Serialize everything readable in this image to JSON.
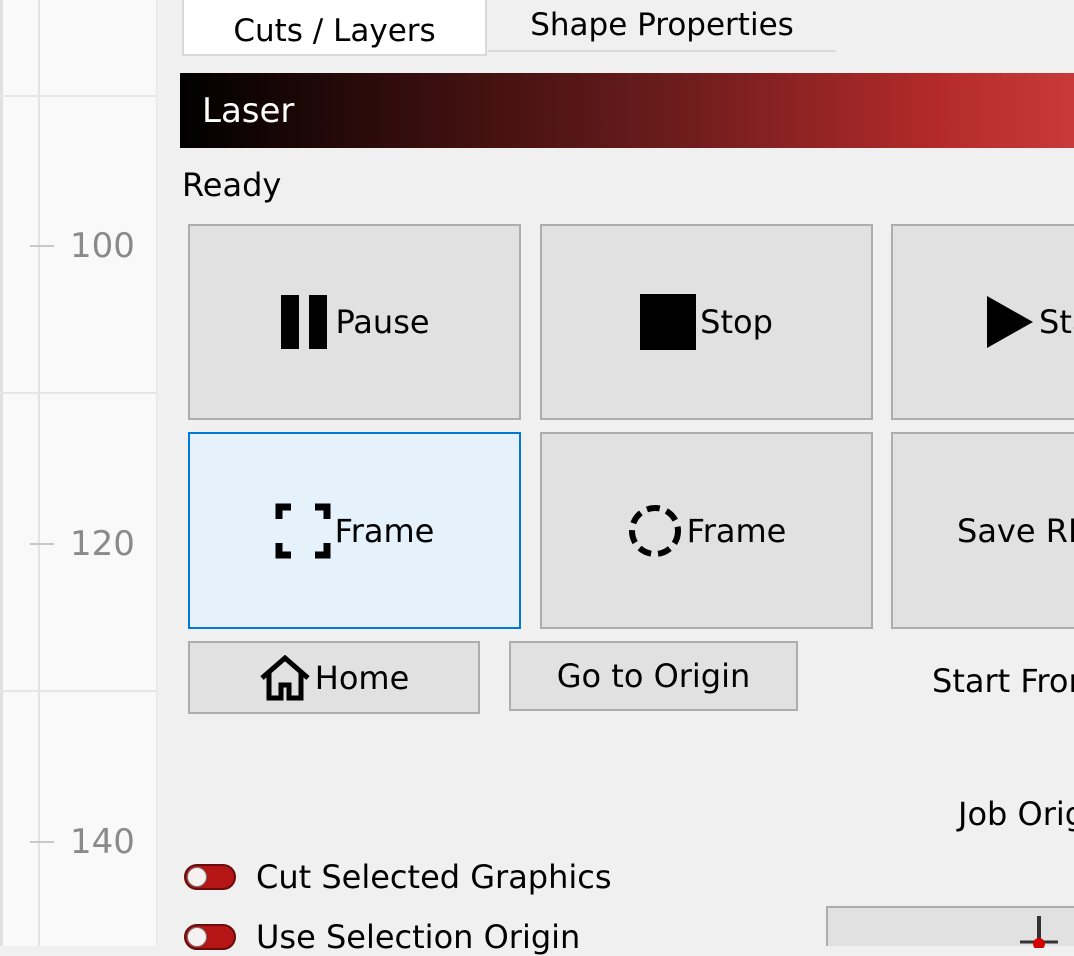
{
  "ruler": {
    "labels": [
      "100",
      "120",
      "140"
    ]
  },
  "tabs": {
    "cuts_layers": "Cuts / Layers",
    "shape_properties": "Shape Properties"
  },
  "panel": {
    "title": "Laser",
    "status": "Ready"
  },
  "buttons": {
    "pause": "Pause",
    "stop": "Stop",
    "start": "Start",
    "frame_rect": "Frame",
    "frame_circle": "Frame",
    "save_rd": "Save RD",
    "home": "Home",
    "go_to_origin": "Go to Origin"
  },
  "labels": {
    "start_from": "Start From",
    "job_origin": "Job Origin"
  },
  "toggles": {
    "cut_selected": "Cut Selected Graphics",
    "use_selection_origin": "Use Selection Origin"
  },
  "colors": {
    "accent": "#0078d7",
    "toggle_red": "#b51515",
    "gradient_end": "#c83a3a"
  }
}
